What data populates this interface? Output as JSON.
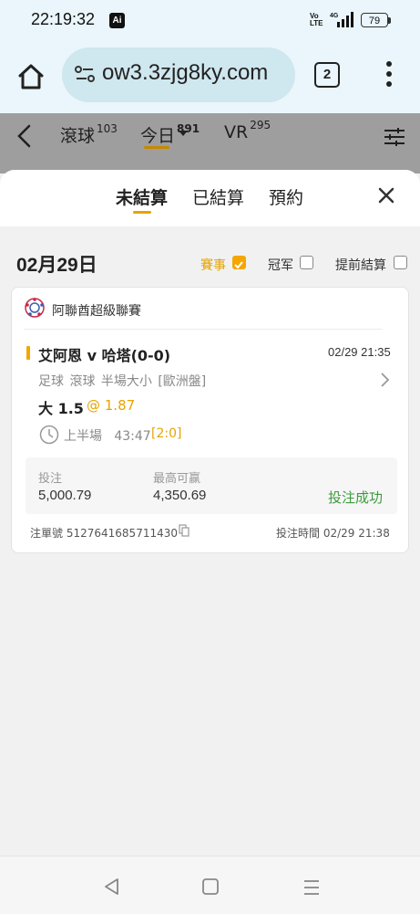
{
  "status_bar": {
    "time": "22:19:32",
    "ai_badge": "Ai",
    "volte": "Vo\nLTE",
    "network": "4G",
    "battery": "79"
  },
  "browser": {
    "url": "ow3.3zjg8ky.com",
    "tab_count": "2"
  },
  "nav": {
    "tabs": [
      {
        "label": "滾球",
        "count": "103"
      },
      {
        "label": "今日",
        "count": "891"
      },
      {
        "label": "VR",
        "count": "295"
      }
    ]
  },
  "sheet": {
    "tabs": [
      "未結算",
      "已結算",
      "預約"
    ]
  },
  "filter": {
    "date": "02月29日",
    "options": [
      "賽事",
      "冠军",
      "提前結算"
    ],
    "checked": [
      true,
      false,
      false
    ]
  },
  "bet": {
    "league": "阿聯酋超級聯賽",
    "match": "艾阿恩 v 哈塔(0-0)",
    "match_time": "02/29 21:35",
    "market": "足球 滾球 半場大小 [歐洲盤]",
    "pick": "大 1.5",
    "odds": "@ 1.87",
    "period": "上半場",
    "clock": "43:47",
    "score": "[2:0]",
    "stake_label": "投注",
    "stake": "5,000.79",
    "max_win_label": "最高可赢",
    "max_win": "4,350.69",
    "status": "投注成功",
    "ticket_label": "注單號",
    "ticket_no": "5127641685711430",
    "bet_time_label": "投注時間",
    "bet_time": "02/29 21:38"
  },
  "colors": {
    "accent": "#f3a700",
    "success": "#3c9a3c",
    "header_gray": "#9e9e9e",
    "browser_bg": "#eaf6fb"
  }
}
